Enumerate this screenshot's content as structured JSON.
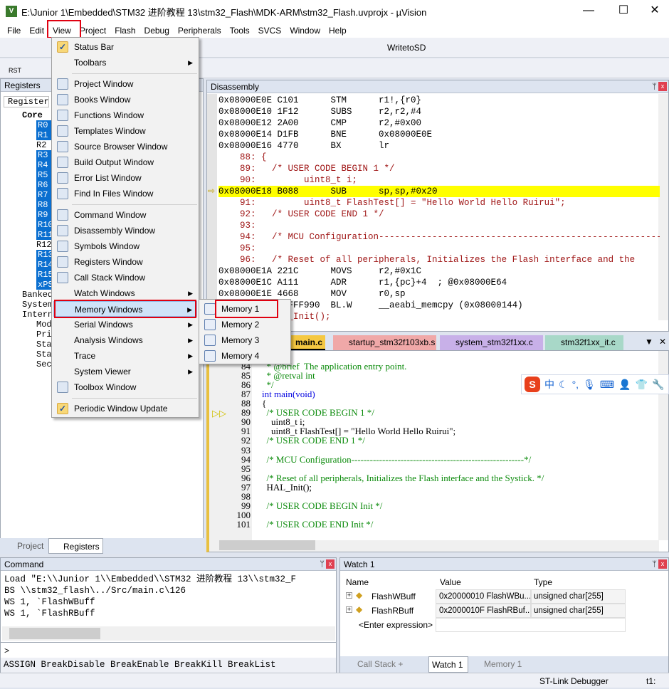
{
  "window": {
    "title": "E:\\Junior 1\\Embedded\\STM32 进阶教程 13\\stm32_Flash\\MDK-ARM\\stm32_Flash.uvprojx - µVision",
    "minimize": "—",
    "maximize": "☐",
    "close": "✕",
    "app_icon": "V"
  },
  "menubar": [
    "File",
    "Edit",
    "View",
    "Project",
    "Flash",
    "Debug",
    "Peripherals",
    "Tools",
    "SVCS",
    "Window",
    "Help"
  ],
  "toolbar": {
    "target": "WritetoSD",
    "rst_label": "RST"
  },
  "registers": {
    "title": "Registers",
    "column": "Register",
    "core": "Core",
    "regs": [
      {
        "n": "R0",
        "s": true
      },
      {
        "n": "R1",
        "s": true
      },
      {
        "n": "R2",
        "s": false
      },
      {
        "n": "R3",
        "s": true
      },
      {
        "n": "R4",
        "s": true
      },
      {
        "n": "R5",
        "s": true
      },
      {
        "n": "R6",
        "s": true
      },
      {
        "n": "R7",
        "s": true
      },
      {
        "n": "R8",
        "s": true
      },
      {
        "n": "R9",
        "s": true
      },
      {
        "n": "R10",
        "s": true
      },
      {
        "n": "R11",
        "s": true
      },
      {
        "n": "R12",
        "s": false
      },
      {
        "n": "R13",
        "s": true
      },
      {
        "n": "R14",
        "s": true
      },
      {
        "n": "R15",
        "s": true
      },
      {
        "n": "xPSR",
        "s": true
      }
    ],
    "groups": [
      "Banked",
      "System",
      "Internal"
    ],
    "internal_items": [
      "Mode",
      "Privilege",
      "Stack",
      "States",
      "Sec"
    ]
  },
  "panel_tabs": {
    "project": "Project",
    "registers": "Registers"
  },
  "disassembly": {
    "title": "Disassembly",
    "lines": [
      {
        "t": "asm",
        "text": "0x08000E0E C101      STM      r1!,{r0}"
      },
      {
        "t": "asm",
        "text": "0x08000E10 1F12      SUBS     r2,r2,#4"
      },
      {
        "t": "asm",
        "text": "0x08000E12 2A00      CMP      r2,#0x00"
      },
      {
        "t": "asm",
        "text": "0x08000E14 D1FB      BNE      0x08000E0E"
      },
      {
        "t": "asm",
        "text": "0x08000E16 4770      BX       lr"
      },
      {
        "t": "src",
        "text": "    88: {"
      },
      {
        "t": "src",
        "text": "    89:   /* USER CODE BEGIN 1 */"
      },
      {
        "t": "src",
        "text": "    90:         uint8_t i;"
      },
      {
        "t": "cur",
        "text": "0x08000E18 B088      SUB      sp,sp,#0x20"
      },
      {
        "t": "src",
        "text": "    91:         uint8_t FlashTest[] = \"Hello World Hello Ruirui\";"
      },
      {
        "t": "src",
        "text": "    92:   /* USER CODE END 1 */"
      },
      {
        "t": "src",
        "text": "    93: "
      },
      {
        "t": "src",
        "text": "    94:   /* MCU Configuration----------------------------------------------------------"
      },
      {
        "t": "src",
        "text": "    95: "
      },
      {
        "t": "src",
        "text": "    96:   /* Reset of all peripherals, Initializes the Flash interface and the"
      },
      {
        "t": "asm",
        "text": "0x08000E1A 221C      MOVS     r2,#0x1C"
      },
      {
        "t": "asm",
        "text": "0x08000E1C A111      ADR      r1,{pc}+4  ; @0x08000E64"
      },
      {
        "t": "asm",
        "text": "0x08000E1E 4668      MOV      r0,sp"
      },
      {
        "t": "asm",
        "text": "0x08000E20 F7FFF990  BL.W     __aeabi_memcpy (0x08000144)"
      },
      {
        "t": "src",
        "text": "    97:   HAL_Init();"
      }
    ]
  },
  "editor_tabs": [
    "main.c",
    "startup_stm32f103xb.s",
    "system_stm32f1xx.c",
    "stm32f1xx_it.c"
  ],
  "editor": {
    "lines": [
      {
        "n": "83",
        "c": "/**",
        "k": "cm"
      },
      {
        "n": "84",
        "c": "  * @brief  The application entry point.",
        "k": "cm"
      },
      {
        "n": "85",
        "c": "  * @retval int",
        "k": "cm"
      },
      {
        "n": "86",
        "c": "  */",
        "k": "cm"
      },
      {
        "n": "87",
        "c": "int main(void)",
        "k": "kw"
      },
      {
        "n": "88",
        "c": "{",
        "k": ""
      },
      {
        "n": "89",
        "c": "  /* USER CODE BEGIN 1 */",
        "k": "cm"
      },
      {
        "n": "90",
        "c": "    uint8_t i;",
        "k": ""
      },
      {
        "n": "91",
        "c": "    uint8_t FlashTest[] = \"Hello World Hello Ruirui\";",
        "k": ""
      },
      {
        "n": "92",
        "c": "  /* USER CODE END 1 */",
        "k": "cm"
      },
      {
        "n": "93",
        "c": "",
        "k": ""
      },
      {
        "n": "94",
        "c": "  /* MCU Configuration--------------------------------------------------------*/",
        "k": "cm"
      },
      {
        "n": "95",
        "c": "",
        "k": ""
      },
      {
        "n": "96",
        "c": "  /* Reset of all peripherals, Initializes the Flash interface and the Systick. */",
        "k": "cm"
      },
      {
        "n": "97",
        "c": "  HAL_Init();",
        "k": ""
      },
      {
        "n": "98",
        "c": "",
        "k": ""
      },
      {
        "n": "99",
        "c": "  /* USER CODE BEGIN Init */",
        "k": "cm"
      },
      {
        "n": "100",
        "c": "",
        "k": ""
      },
      {
        "n": "101",
        "c": "  /* USER CODE END Init */",
        "k": "cm"
      }
    ]
  },
  "ime": {
    "logo": "S",
    "mode": "中",
    "icons": [
      "moon-icon",
      "punctuation-icon",
      "microphone-icon",
      "keyboard-icon",
      "user-icon",
      "skin-icon",
      "wrench-icon"
    ]
  },
  "command": {
    "title": "Command",
    "lines": [
      "Load \"E:\\\\Junior 1\\\\Embedded\\\\STM32 进阶教程 13\\\\stm32_F",
      "BS \\\\stm32_flash\\../Src/main.c\\126",
      "WS 1, `FlashWBuff",
      "WS 1, `FlashRBuff"
    ],
    "prompt": ">",
    "hint": "ASSIGN BreakDisable BreakEnable BreakKill BreakList"
  },
  "watch": {
    "title": "Watch 1",
    "columns": [
      "Name",
      "Value",
      "Type"
    ],
    "rows": [
      {
        "name": "FlashWBuff",
        "value": "0x20000010 FlashWBu...",
        "type": "unsigned char[255]"
      },
      {
        "name": "FlashRBuff",
        "value": "0x2000010F FlashRBuf...",
        "type": "unsigned char[255]"
      }
    ],
    "enter": "<Enter expression>",
    "tabs": [
      "Call Stack + Locals",
      "Watch 1",
      "Memory 1"
    ]
  },
  "statusbar": {
    "debugger": "ST-Link Debugger",
    "t1": "t1:"
  },
  "view_menu": {
    "items": [
      {
        "label": "Status Bar",
        "icon": "check-icon",
        "check": true
      },
      {
        "label": "Toolbars",
        "sub": true
      },
      {
        "sep": true
      },
      {
        "label": "Project Window",
        "icon": "project-window-icon"
      },
      {
        "label": "Books Window",
        "icon": "books-icon"
      },
      {
        "label": "Functions Window",
        "icon": "functions-icon"
      },
      {
        "label": "Templates Window",
        "icon": "templates-icon"
      },
      {
        "label": "Source Browser Window",
        "icon": "source-browser-icon"
      },
      {
        "label": "Build Output Window",
        "icon": "build-output-icon"
      },
      {
        "label": "Error List Window",
        "icon": "error-list-icon"
      },
      {
        "label": "Find In Files Window",
        "icon": "find-in-files-icon"
      },
      {
        "sep": true
      },
      {
        "label": "Command Window",
        "icon": "command-window-icon"
      },
      {
        "label": "Disassembly Window",
        "icon": "disassembly-icon"
      },
      {
        "label": "Symbols Window",
        "icon": "symbols-icon"
      },
      {
        "label": "Registers Window",
        "icon": "registers-icon"
      },
      {
        "label": "Call Stack Window",
        "icon": "call-stack-icon"
      },
      {
        "label": "Watch Windows",
        "sub": true
      },
      {
        "label": "Memory Windows",
        "sub": true,
        "active": true
      },
      {
        "label": "Serial Windows",
        "sub": true
      },
      {
        "label": "Analysis Windows",
        "sub": true
      },
      {
        "label": "Trace",
        "sub": true
      },
      {
        "label": "System Viewer",
        "sub": true
      },
      {
        "label": "Toolbox Window",
        "icon": "toolbox-icon"
      },
      {
        "sep": true
      },
      {
        "label": "Periodic Window Update",
        "icon": "check-icon",
        "check": true
      }
    ]
  },
  "memory_submenu": [
    "Memory 1",
    "Memory 2",
    "Memory 3",
    "Memory 4"
  ],
  "colors": {
    "highlight": "#ffff00",
    "selection": "#0a6fd0",
    "annotation_box": "#e00010",
    "tab_main": "#f5c842",
    "tab_startup": "#f0a8a8",
    "tab_system": "#c8b0e8",
    "tab_it": "#a8d8c8"
  }
}
